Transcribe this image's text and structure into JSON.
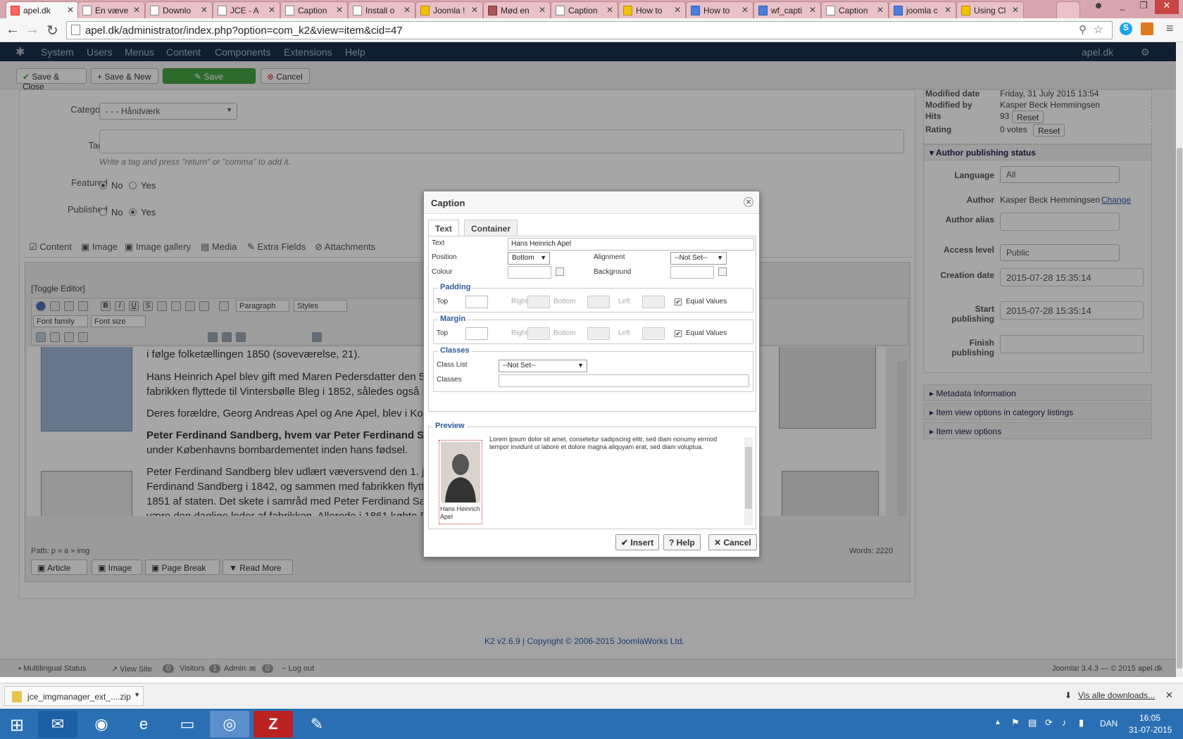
{
  "browser": {
    "tabs": [
      {
        "label": "apel.dk",
        "active": true
      },
      {
        "label": "En væve"
      },
      {
        "label": "Downlo"
      },
      {
        "label": "JCE - A"
      },
      {
        "label": "Caption"
      },
      {
        "label": "Install o"
      },
      {
        "label": "Joomla !"
      },
      {
        "label": "Mød en"
      },
      {
        "label": "Caption"
      },
      {
        "label": "How to"
      },
      {
        "label": "How to"
      },
      {
        "label": "wf_capti"
      },
      {
        "label": "Caption"
      },
      {
        "label": "joomla c"
      },
      {
        "label": "Using Cl"
      }
    ],
    "url": "apel.dk/administrator/index.php?option=com_k2&view=item&cid=47"
  },
  "joomla_nav": {
    "menu": [
      "System",
      "Users",
      "Menus",
      "Content",
      "Components",
      "Extensions",
      "Help"
    ],
    "site_link": "apel.dk"
  },
  "toolbar": {
    "save_close": "Save & Close",
    "save_new": "Save & New",
    "save": "Save",
    "cancel": "Cancel"
  },
  "form": {
    "category_label": "Category",
    "category_value": "- - - Håndværk",
    "tags_label": "Tags",
    "tags_hint": "Write a tag and press \"return\" or \"comma\" to add it.",
    "featured_label": "Featured",
    "published_label": "Published",
    "no": "No",
    "yes": "Yes"
  },
  "content_tabs": [
    "Content",
    "Image",
    "Image gallery",
    "Media",
    "Extra Fields",
    "Attachments"
  ],
  "editor": {
    "toggle": "[Toggle Editor]",
    "paragraph": "Paragraph",
    "styles": "Styles",
    "font_family": "Font family",
    "font_size": "Font size",
    "lines": [
      "i følge folketællingen 1850 (soveværelse, 21).",
      "Hans Heinrich Apel blev gift med Maren Pedersdatter den 5. m",
      "fabrikken flyttede til Vintersbølle Bleg i 1852, således også H",
      "Deres forældre, Georg Andreas Apel og Ane Apel, blev i Kong",
      "Peter Ferdinand Sandberg, hvem var Peter Ferdinand Sand",
      "under Københavns bombardementet inden hans fødsel.",
      "Peter Ferdinand Sandberg blev udlært væversvend den 1. jun",
      "Ferdinand Sandberg i 1842, og sammen med fabrikken flytted",
      "1851 af staten. Det skete i samråd med Peter Ferdinand Sand",
      "være den daglige leder af fabrikken. Allerede i 1861 købte P.E"
    ],
    "path": "Path:  p » a » img",
    "words": "Words: 2220",
    "buttons": [
      "Article",
      "Image",
      "Page Break",
      "Read More"
    ]
  },
  "right_panel": {
    "modified_date_label": "Modified date",
    "modified_date": "Friday, 31 July 2015 13:54",
    "modified_by_label": "Modified by",
    "modified_by": "Kasper Beck Hemmingsen",
    "hits_label": "Hits",
    "hits": "93",
    "rating_label": "Rating",
    "rating": "0 votes",
    "reset": "Reset",
    "author_section": "Author publishing status",
    "language_label": "Language",
    "language": "All",
    "author_label": "Author",
    "author": "Kasper Beck Hemmingsen",
    "change": "Change",
    "author_alias_label": "Author alias",
    "access_label": "Access level",
    "access": "Public",
    "creation_label": "Creation date",
    "creation": "2015-07-28 15:35:14",
    "start_label": "Start publishing",
    "start": "2015-07-28 15:35:14",
    "finish_label": "Finish publishing",
    "accordions": [
      "Metadata Information",
      "Item view options in category listings",
      "Item view options"
    ]
  },
  "footer": {
    "copyright": "K2 v2.6.9 | Copyright © 2006-2015 JoomlaWorks Ltd.",
    "multilingual": "Multilingual Status",
    "view_site": "View Site",
    "visitors_count": "0",
    "visitors": "Visitors",
    "admin_count": "1",
    "admin": "Admin",
    "msg_count": "0",
    "logout": "Log out",
    "version": "Joomla! 3.4.3 — © 2015 apel.dk"
  },
  "dialog": {
    "title": "Caption",
    "tab_text": "Text",
    "tab_container": "Container",
    "text_label": "Text",
    "text_value": "Hans Heinrich Apel",
    "position_label": "Position",
    "position_value": "Bottom",
    "alignment_label": "Alignment",
    "alignment_value": "--Not Set--",
    "colour_label": "Colour",
    "background_label": "Background",
    "padding": "Padding",
    "margin": "Margin",
    "top": "Top",
    "right": "Right",
    "bottom": "Bottom",
    "left": "Left",
    "equal_values": "Equal Values",
    "classes_section": "Classes",
    "class_list_label": "Class List",
    "class_list_value": "--Not Set--",
    "classes_label": "Classes",
    "preview": "Preview",
    "preview_text": "Lorem ipsum dolor sit amet, consetetur sadipscing elitr, sed diam nonumy eirmod tempor invidunt ut labore et dolore magna aliquyam erat, sed diam voluptua.",
    "preview_caption": "Hans Heinrich Apel",
    "insert": "Insert",
    "help": "Help",
    "cancel": "Cancel"
  },
  "downloads": {
    "file": "jce_imgmanager_ext_....zip",
    "show_all": "Vis alle downloads..."
  },
  "taskbar": {
    "lang": "DAN",
    "time": "16:05",
    "date": "31-07-2015"
  }
}
